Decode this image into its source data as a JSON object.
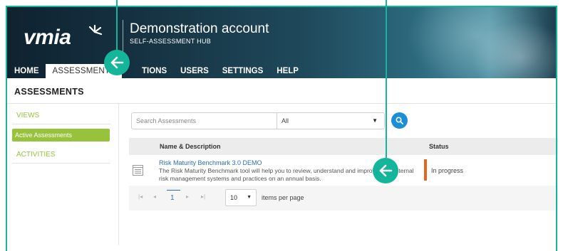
{
  "app": {
    "logo_text": "vmia",
    "account_title": "Demonstration account",
    "account_subtitle": "SELF-ASSESSMENT HUB"
  },
  "nav": {
    "items": [
      {
        "label": "HOME",
        "active": false
      },
      {
        "label": "ASSESSMENTS",
        "active": true
      },
      {
        "label": "ACTIONS",
        "visible_label": "TIONS",
        "active": false
      },
      {
        "label": "USERS",
        "active": false
      },
      {
        "label": "SETTINGS",
        "active": false
      },
      {
        "label": "HELP",
        "active": false
      }
    ]
  },
  "page": {
    "title": "ASSESSMENTS"
  },
  "sidebar": {
    "views_heading": "VIEWS",
    "active_item": "Active Assessments",
    "activities_heading": "ACTIVITIES"
  },
  "filters": {
    "search_placeholder": "Search Assessments",
    "select_value": "All"
  },
  "table": {
    "columns": [
      "Name & Description",
      "Status"
    ],
    "rows": [
      {
        "name": "Risk Maturity Benchmark 3.0 DEMO",
        "description": "The Risk Maturity Benchmark tool will help you to review, understand and improve your internal risk management systems and practices on an annual basis.",
        "status": "In progress",
        "status_color": "#e4671f"
      }
    ]
  },
  "pagination": {
    "current_page": "1",
    "per_page": "10",
    "per_page_label": "items per page",
    "first_icon": "first-page-icon",
    "prev_icon": "prev-page-icon",
    "next_icon": "next-page-icon",
    "last_icon": "last-page-icon"
  },
  "colors": {
    "accent_green": "#97c23c",
    "callout_teal": "#14b59a",
    "link_blue": "#2a6fb6",
    "search_button_blue": "#1a8fd8"
  }
}
